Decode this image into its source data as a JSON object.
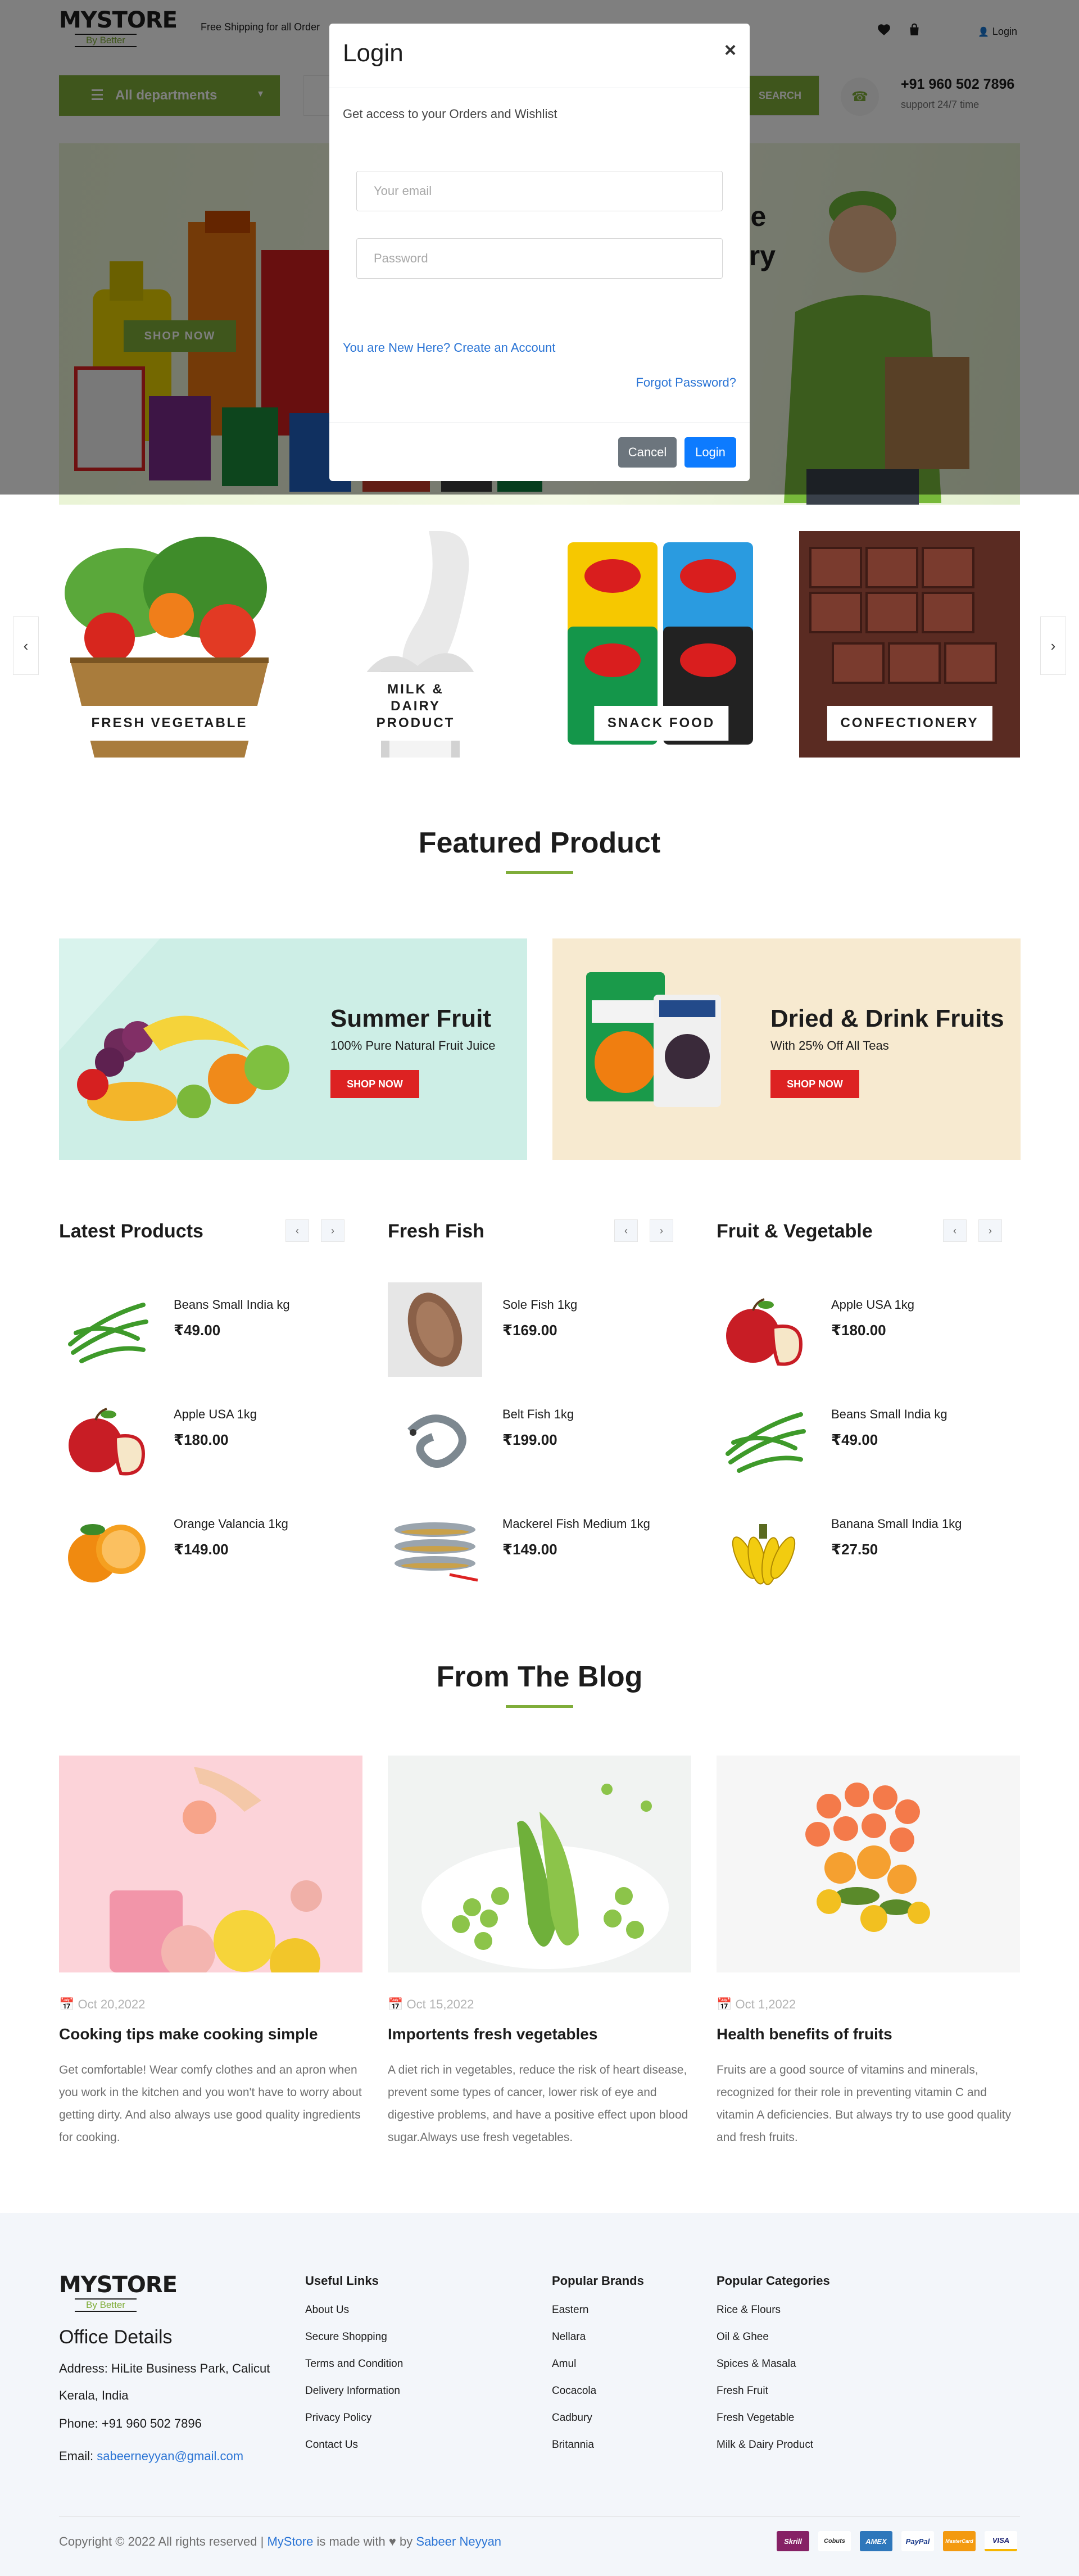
{
  "header": {
    "logo_main": "MYSTORE",
    "logo_sub": "By Better",
    "shipping_text": "Free Shipping for all Order",
    "login_label": "Login"
  },
  "nav": {
    "all_departments": "All departments",
    "search_button": "SEARCH",
    "phone": "+91 960 502 7896",
    "phone_sub": "support 24/7 time"
  },
  "hero": {
    "title_line1": "ne",
    "title_line2": "ery",
    "button": "SHOP NOW"
  },
  "categories": [
    {
      "label": "FRESH VEGETABLE"
    },
    {
      "label": "MILK & DAIRY PRODUCT"
    },
    {
      "label": "SNACK FOOD"
    },
    {
      "label": "CONFECTIONERY"
    }
  ],
  "featured": {
    "title": "Featured Product"
  },
  "banners": [
    {
      "title": "Summer Fruit",
      "subtitle": "100% Pure Natural Fruit Juice",
      "button": "SHOP NOW"
    },
    {
      "title": "Dried & Drink Fruits",
      "subtitle": "With 25% Off All Teas",
      "button": "SHOP NOW"
    }
  ],
  "product_lists": [
    {
      "title": "Latest Products",
      "items": [
        {
          "name": "Beans Small India kg",
          "price": "₹49.00",
          "icon": "beans-image"
        },
        {
          "name": "Apple USA 1kg",
          "price": "₹180.00",
          "icon": "apple-image"
        },
        {
          "name": "Orange Valancia 1kg",
          "price": "₹149.00",
          "icon": "orange-image"
        }
      ]
    },
    {
      "title": "Fresh Fish",
      "items": [
        {
          "name": "Sole Fish 1kg",
          "price": "₹169.00",
          "icon": "sole-fish-image"
        },
        {
          "name": "Belt Fish 1kg",
          "price": "₹199.00",
          "icon": "belt-fish-image"
        },
        {
          "name": "Mackerel Fish Medium 1kg",
          "price": "₹149.00",
          "icon": "mackerel-fish-image"
        }
      ]
    },
    {
      "title": "Fruit & Vegetable",
      "items": [
        {
          "name": "Apple USA 1kg",
          "price": "₹180.00",
          "icon": "apple-image"
        },
        {
          "name": "Beans Small India kg",
          "price": "₹49.00",
          "icon": "beans-image"
        },
        {
          "name": "Banana Small India 1kg",
          "price": "₹27.50",
          "icon": "banana-image"
        }
      ]
    }
  ],
  "blog": {
    "title": "From The Blog",
    "posts": [
      {
        "date": "Oct 20,2022",
        "title": "Cooking tips make cooking simple",
        "text": "Get comfortable! Wear comfy clothes and an apron when you work in the kitchen and you won't have to worry about getting dirty. And also always use good quality ingredients for cooking."
      },
      {
        "date": "Oct 15,2022",
        "title": "Importents fresh vegetables",
        "text": "A diet rich in vegetables, reduce the risk of heart disease, prevent some types of cancer, lower risk of eye and digestive problems, and have a positive effect upon blood sugar.Always use fresh vegetables."
      },
      {
        "date": "Oct 1,2022",
        "title": "Health benefits of fruits",
        "text": "Fruits are a good source of vitamins and minerals, recognized for their role in preventing vitamin C and vitamin A deficiencies. But always try to use good quality and fresh fruits."
      }
    ]
  },
  "footer": {
    "office_title": "Office Details",
    "address": "Address: HiLite Business Park, Calicut",
    "region": "Kerala, India",
    "phone": "Phone: +91 960 502 7896",
    "email_label": "Email: ",
    "email": "sabeerneyyan@gmail.com",
    "useful_links_title": "Useful Links",
    "useful_links": [
      "About Us",
      "Secure Shopping",
      "Terms and Condition",
      "Delivery Information",
      "Privacy Policy",
      "Contact Us"
    ],
    "brands_title": "Popular Brands",
    "brands": [
      "Eastern",
      "Nellara",
      "Amul",
      "Cocacola",
      "Cadbury",
      "Britannia"
    ],
    "categories_title": "Popular Categories",
    "categories": [
      "Rice & Flours",
      "Oil & Ghee",
      "Spices & Masala",
      "Fresh Fruit",
      "Fresh Vegetable",
      "Milk & Dairy Product"
    ],
    "copyright_prefix": "Copyright © 2022 All rights reserved | ",
    "copyright_store": "MyStore",
    "copyright_mid": " is made with ",
    "copyright_by": " by ",
    "copyright_author": "Sabeer Neyyan",
    "payments": [
      "Skrill",
      "Cobuts",
      "AMEX",
      "PayPal",
      "MasterCard",
      "VISA"
    ]
  },
  "modal": {
    "title": "Login",
    "close": "×",
    "subtitle": "Get access to your Orders and Wishlist",
    "email_placeholder": "Your email",
    "password_placeholder": "Password",
    "create_account": "You are New Here? Create an Account",
    "forgot_password": "Forgot Password?",
    "cancel": "Cancel",
    "login": "Login"
  },
  "colors": {
    "accent": "#7fad39",
    "banner_red": "#dd2222",
    "link_blue": "#2a74d5",
    "login_blue": "#0d7bff",
    "cancel_gray": "#6c757d"
  }
}
